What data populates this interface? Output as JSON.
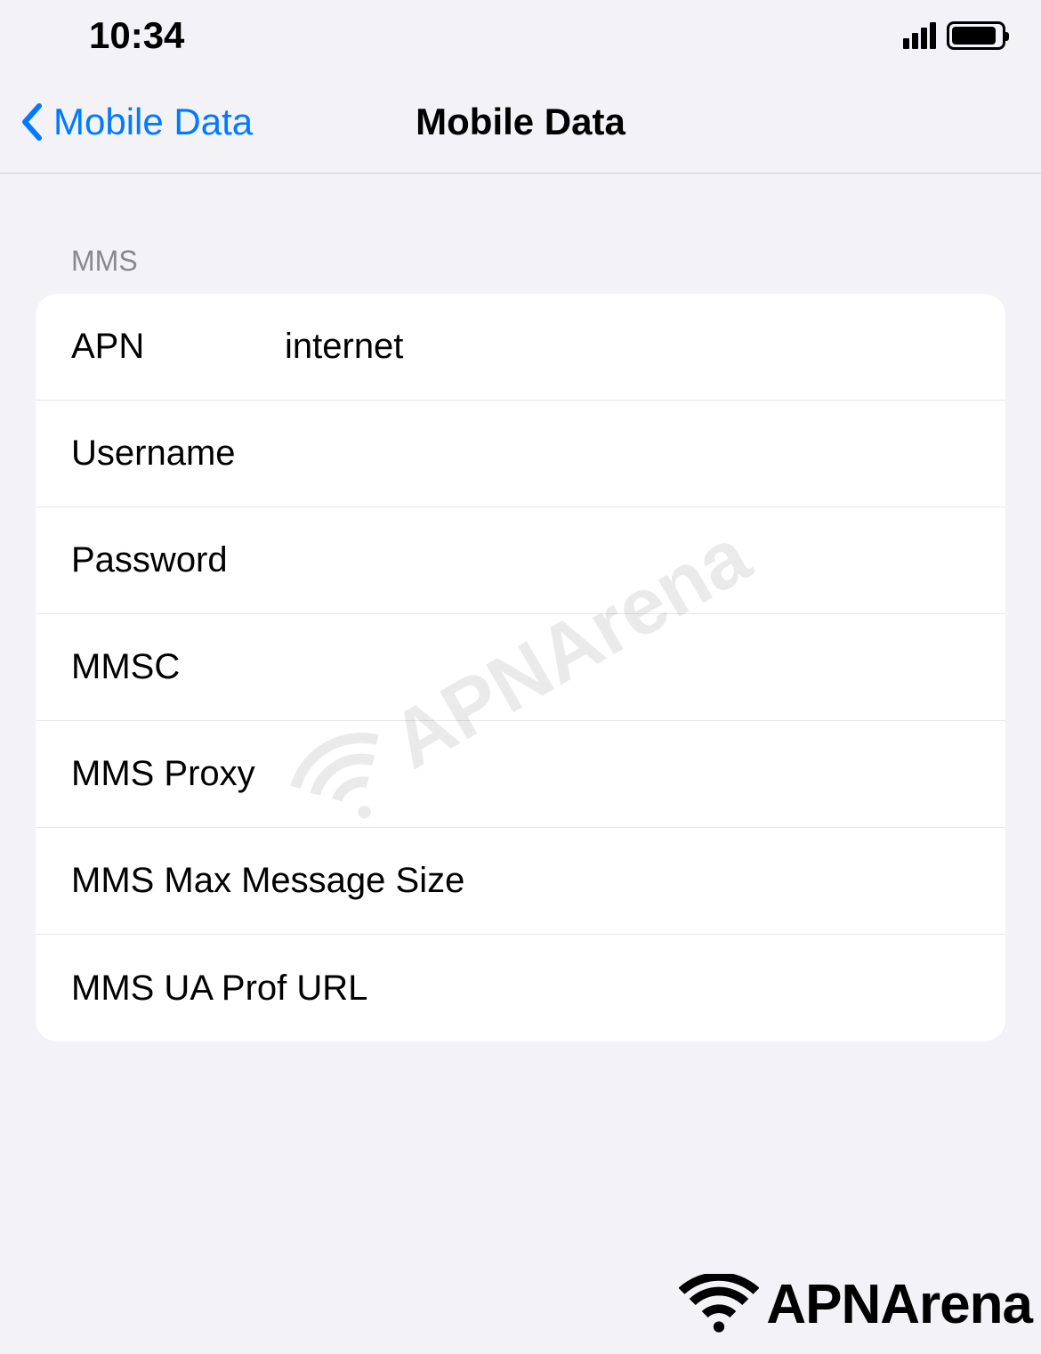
{
  "statusBar": {
    "time": "10:34"
  },
  "nav": {
    "backLabel": "Mobile Data",
    "title": "Mobile Data"
  },
  "section": {
    "header": "MMS",
    "rows": [
      {
        "label": "APN",
        "value": "internet"
      },
      {
        "label": "Username",
        "value": ""
      },
      {
        "label": "Password",
        "value": ""
      },
      {
        "label": "MMSC",
        "value": ""
      },
      {
        "label": "MMS Proxy",
        "value": ""
      },
      {
        "label": "MMS Max Message Size",
        "value": ""
      },
      {
        "label": "MMS UA Prof URL",
        "value": ""
      }
    ]
  },
  "watermark": {
    "text": "APNArena"
  }
}
